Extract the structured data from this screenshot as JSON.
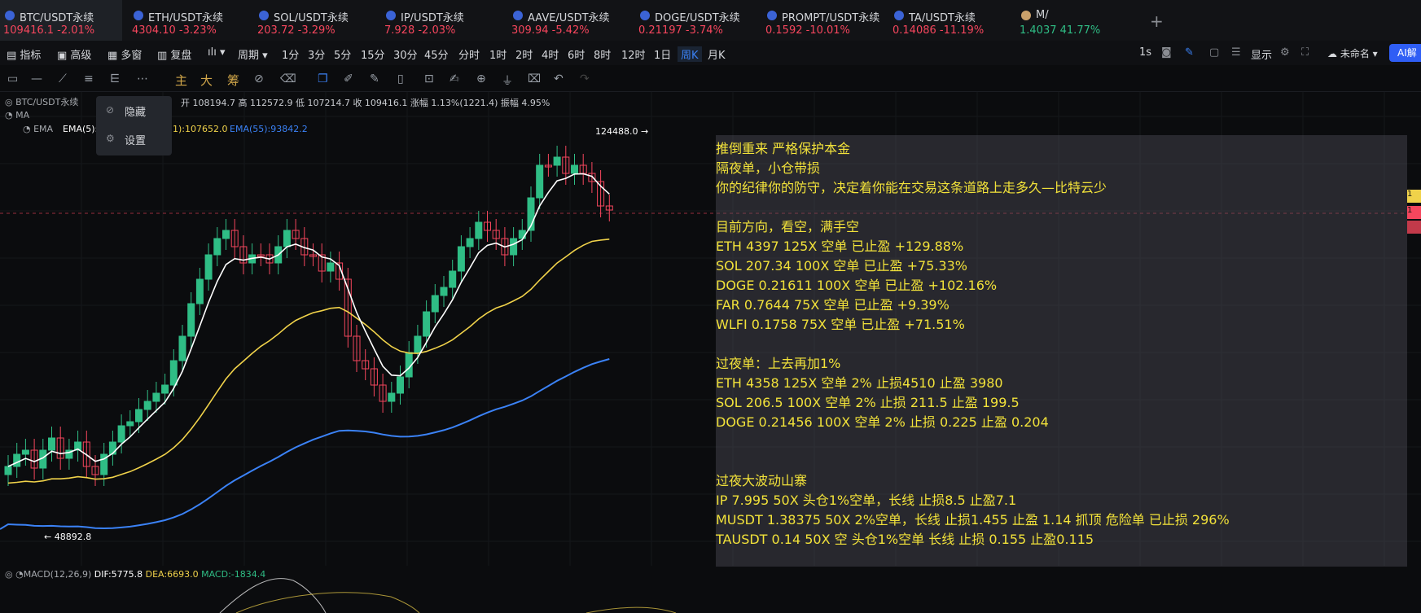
{
  "tabs": [
    {
      "name": "BTC/USDT永续",
      "price": "109416.1",
      "change": "-2.01%",
      "dir": "down"
    },
    {
      "name": "ETH/USDT永续",
      "price": "4304.10",
      "change": "-3.23%",
      "dir": "down"
    },
    {
      "name": "SOL/USDT永续",
      "price": "203.72",
      "change": "-3.29%",
      "dir": "down"
    },
    {
      "name": "IP/USDT永续",
      "price": "7.928",
      "change": "-2.03%",
      "dir": "down"
    },
    {
      "name": "AAVE/USDT永续",
      "price": "309.94",
      "change": "-5.42%",
      "dir": "down"
    },
    {
      "name": "DOGE/USDT永续",
      "price": "0.21197",
      "change": "-3.74%",
      "dir": "down"
    },
    {
      "name": "PROMPT/USDT永续",
      "price": "0.1592",
      "change": "-10.01%",
      "dir": "down"
    },
    {
      "name": "TA/USDT永续",
      "price": "0.14086",
      "change": "-11.19%",
      "dir": "down"
    },
    {
      "name": "M/",
      "price": "1.4037",
      "change": "41.77%",
      "dir": "up"
    }
  ],
  "toolbar": {
    "indicators": "指标",
    "advanced": "高级",
    "multi": "多窗",
    "replay": "复盘",
    "period": "周期",
    "periods": [
      "1分",
      "3分",
      "5分",
      "15分",
      "30分",
      "45分",
      "分时",
      "1时",
      "2时",
      "4时",
      "6时",
      "8时",
      "12时",
      "1日",
      "周K",
      "月K"
    ],
    "right_interval": "1s",
    "display": "显示",
    "user": "未命名",
    "ai": "AI解"
  },
  "tools2": {
    "main": "主",
    "big": "大",
    "chips": "筹"
  },
  "legend": {
    "symbol": "BTC/USDT永续",
    "ohlc": "开 108194.7  高 112572.9  低 107214.7  收 109416.1  涨幅 1.13%(1221.4)  振幅 4.95%",
    "ma": "MA",
    "ema_label": "EMA",
    "ema5": "EMA(5):",
    "ema21": "1):107652.0",
    "ema55": "EMA(55):93842.2",
    "high_mark": "124488.0 →",
    "low_mark": "← 48892.8",
    "macd": "MACD(12,26,9)",
    "dif": "DIF:5775.8",
    "dea": "DEA:6693.0",
    "macd_val": "MACD:-1834.4"
  },
  "popup": {
    "hide": "隐藏",
    "settings": "设置"
  },
  "notes": [
    "推倒重来 严格保护本金",
    "隔夜单，小仓带损",
    "你的纪律你的防守，决定着你能在交易这条道路上走多久—比特云少",
    "",
    "目前方向，看空，满手空",
    "ETH 4397 125X 空单 已止盈 +129.88%",
    "SOL 207.34 100X 空单 已止盈 +75.33%",
    "DOGE 0.21611 100X 空单 已止盈 +102.16%",
    "FAR 0.7644 75X 空单 已止盈 +9.39%",
    "WLFI 0.1758 75X 空单 已止盈 +71.51%",
    "",
    "过夜单：上去再加1%",
    "ETH 4358 125X 空单 2% 止损4510 止盈 3980",
    "SOL 206.5 100X 空单 2% 止损 211.5 止盈 199.5",
    "DOGE 0.21456 100X 空单 2% 止损 0.225 止盈 0.204",
    "",
    "",
    "过夜大波动山寨",
    "IP 7.995 50X 头仓1%空单，长线 止损8.5 止盈7.1",
    "MUSDT 1.38375 50X 2%空单，长线  止损1.455 止盈 1.14 抓顶 危险单 已止损 296%",
    "TAUSDT 0.14 50X 空 头仓1%空单 长线 止损 0.155 止盈0.115"
  ],
  "colors": {
    "up": "#2fbd85",
    "down": "#f6465d",
    "ema5": "#ffffff",
    "ema21": "#f0d24a",
    "ema55": "#3b82f6",
    "notes": "#f2e23a",
    "accent": "#3b82f6"
  }
}
